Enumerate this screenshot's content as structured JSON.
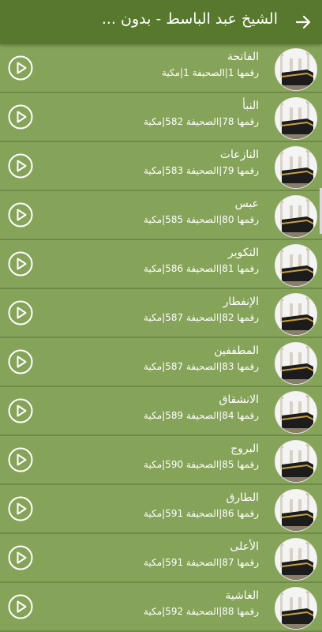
{
  "appbar": {
    "title": "الشيخ عبد الباسط - بدون ...",
    "back_icon": "arrow-forward-icon"
  },
  "colors": {
    "appbar_bg": "#58782d",
    "list_bg": "#86a35a",
    "divider": "#6f8a48",
    "text": "#ffffff"
  },
  "items": [
    {
      "name": "الفاتحة",
      "meta": "رقمها 1|الصحيفة 1|مكية"
    },
    {
      "name": "النبأ",
      "meta": "رقمها 78|الصحيفة 582|مكية"
    },
    {
      "name": "النازعات",
      "meta": "رقمها 79|الصحيفة 583|مكية"
    },
    {
      "name": "عبس",
      "meta": "رقمها 80|الصحيفة 585|مكية"
    },
    {
      "name": "التكوير",
      "meta": "رقمها 81|الصحيفة 586|مكية"
    },
    {
      "name": "الإنفطار",
      "meta": "رقمها 82|الصحيفة 587|مكية"
    },
    {
      "name": "المطففين",
      "meta": "رقمها 83|الصحيفة 587|مكية"
    },
    {
      "name": "الانشقاق",
      "meta": "رقمها 84|الصحيفة 589|مكية"
    },
    {
      "name": "البروج",
      "meta": "رقمها 85|الصحيفة 590|مكية"
    },
    {
      "name": "الطارق",
      "meta": "رقمها 86|الصحيفة 591|مكية"
    },
    {
      "name": "الأعلى",
      "meta": "رقمها 87|الصحيفة 591|مكية"
    },
    {
      "name": "الغاشية",
      "meta": "رقمها 88|الصحيفة 592|مكية"
    }
  ]
}
